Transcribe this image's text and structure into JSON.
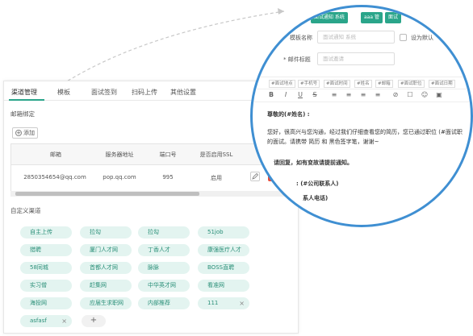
{
  "tabs": [
    "渠道管理",
    "模板",
    "面试签到",
    "扫码上传",
    "其他设置"
  ],
  "mail_section_label": "邮箱绑定",
  "add_button_label": "添加",
  "table": {
    "headers": [
      "邮箱",
      "服务器地址",
      "端口号",
      "是否启用SSL",
      "操作"
    ],
    "rows": [
      [
        "2850354654@qq.com",
        "pop.qq.com",
        "995",
        "启用"
      ]
    ]
  },
  "custom_section_label": "自定义渠道",
  "channels": [
    [
      "自主上传",
      "拉勾",
      "拉勾",
      "51job"
    ],
    [
      "猎聘",
      "厦门人才网",
      "丁香人才",
      "康强医疗人才"
    ],
    [
      "58同城",
      "首都人才网",
      "脉脉",
      "BOSS直聘"
    ],
    [
      "实习僧",
      "赶集网",
      "中华英才网",
      "看准网"
    ],
    [
      "海投网",
      "应届生求职网",
      "内部推荐",
      "111"
    ],
    [
      "asfasf"
    ]
  ],
  "tag_add_label": "+",
  "lens": {
    "top_buttons": [
      "面试通知 系统",
      "aaa 管",
      "面试"
    ],
    "template_name_label": "模板名称",
    "template_name_placeholder": "面试通知 系统",
    "default_checkbox_label": "设为默认",
    "subject_label": "* 邮件标题",
    "subject_placeholder": "面试邀请",
    "variables": [
      "#面试地点",
      "#手机号",
      "#面试时间",
      "#姓名",
      "#邮箱",
      "#面试职位",
      "#面试日期"
    ],
    "toolbar_icons": [
      "B",
      "I",
      "U",
      "S",
      "≡",
      "≡",
      "≡",
      "≡",
      "⊘",
      "☐",
      "☺",
      "▣"
    ],
    "body_lines": [
      "尊敬的(#姓名) :",
      "您好，很高兴与您沟通，经过我们仔细查看您的简历，您已通过职位 (#面试职",
      "的面试。请携带 简历 和 黑色签字笔，谢谢~",
      "请回复，如有变故请提前通知。",
      ": (#公司联系人)",
      "系人电话)"
    ]
  },
  "colors": {
    "accent": "#2aa58a",
    "tag_bg": "#e3f4f0",
    "lens_border": "#3f8fd2",
    "danger": "#e74c3c"
  }
}
